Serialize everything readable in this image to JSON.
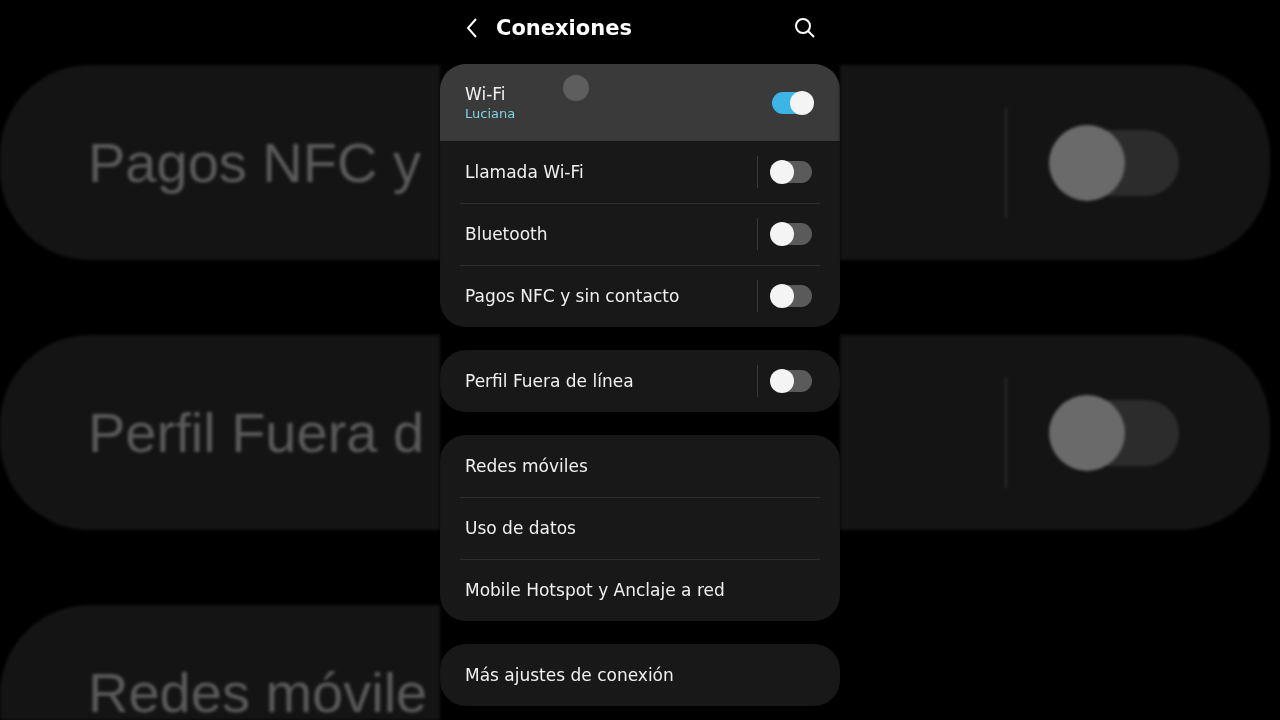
{
  "backdrop": {
    "left": [
      {
        "label": "Pagos NFC y"
      },
      {
        "label": "Perfil Fuera d"
      },
      {
        "label": "Redes móvile"
      }
    ],
    "right": [
      {
        "on": false
      },
      {
        "on": false
      }
    ]
  },
  "header": {
    "title": "Conexiones"
  },
  "groups": [
    {
      "items": [
        {
          "kind": "toggle",
          "label": "Wi-Fi",
          "subtitle": "Luciana",
          "on": true,
          "pressed": true
        },
        {
          "kind": "toggle",
          "label": "Llamada Wi-Fi",
          "on": false,
          "pressed": false
        },
        {
          "kind": "toggle",
          "label": "Bluetooth",
          "on": false,
          "pressed": false
        },
        {
          "kind": "toggle",
          "label": "Pagos NFC y sin contacto",
          "on": false,
          "pressed": false
        }
      ]
    },
    {
      "items": [
        {
          "kind": "toggle",
          "label": "Perfil Fuera de línea",
          "on": false,
          "pressed": false
        }
      ]
    },
    {
      "items": [
        {
          "kind": "link",
          "label": "Redes móviles",
          "pressed": false
        },
        {
          "kind": "link",
          "label": "Uso de datos",
          "pressed": false
        },
        {
          "kind": "link",
          "label": "Mobile Hotspot y Anclaje a red",
          "pressed": false
        }
      ]
    },
    {
      "items": [
        {
          "kind": "link",
          "label": "Más ajustes de conexión",
          "pressed": false
        }
      ]
    }
  ]
}
